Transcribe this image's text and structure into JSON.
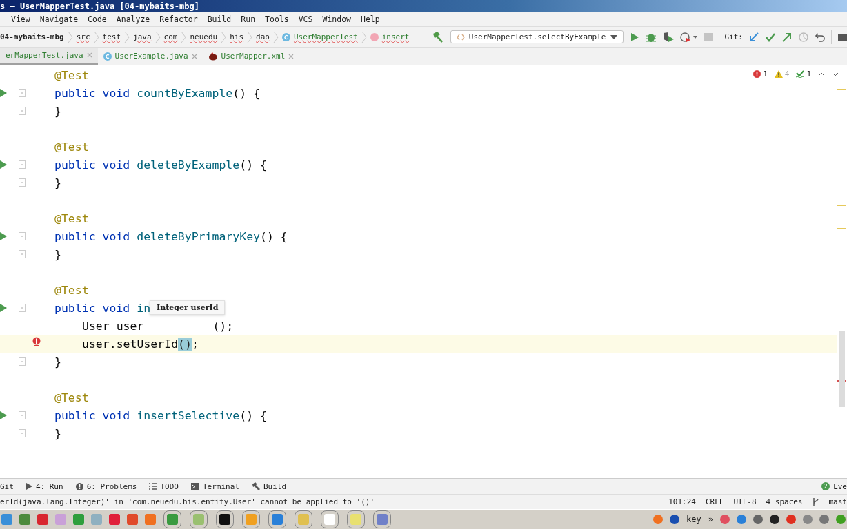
{
  "window": {
    "title": "s – UserMapperTest.java [04-mybaits-mbg]"
  },
  "menu": [
    "View",
    "Navigate",
    "Code",
    "Analyze",
    "Refactor",
    "Build",
    "Run",
    "Tools",
    "VCS",
    "Window",
    "Help"
  ],
  "breadcrumbs": [
    {
      "label": "04-mybaits-mbg",
      "kind": "project"
    },
    {
      "label": "src",
      "kind": "folder"
    },
    {
      "label": "test",
      "kind": "folder"
    },
    {
      "label": "java",
      "kind": "folder"
    },
    {
      "label": "com",
      "kind": "folder"
    },
    {
      "label": "neuedu",
      "kind": "folder"
    },
    {
      "label": "his",
      "kind": "folder"
    },
    {
      "label": "dao",
      "kind": "folder"
    },
    {
      "label": "UserMapperTest",
      "kind": "class"
    },
    {
      "label": "insert",
      "kind": "method"
    }
  ],
  "run_config": "UserMapperTest.selectByExample",
  "git_label": "Git:",
  "tabs": [
    {
      "label": "erMapperTest.java",
      "selected": true,
      "kind": "none"
    },
    {
      "label": "UserExample.java",
      "selected": false,
      "kind": "class"
    },
    {
      "label": "UserMapper.xml",
      "selected": false,
      "kind": "xml"
    }
  ],
  "inspections": {
    "errors": "1",
    "warnings": "4",
    "typos": "1"
  },
  "code": [
    {
      "kind": "plain",
      "segments": [
        {
          "kind": "annotation",
          "text": "@Test"
        }
      ]
    },
    {
      "kind": "run",
      "segments": [
        {
          "kind": "keyword",
          "text": "public void "
        },
        {
          "kind": "method",
          "text": "countByExample"
        },
        {
          "kind": "plain",
          "text": "() {"
        }
      ]
    },
    {
      "kind": "fold",
      "segments": [
        {
          "kind": "plain",
          "text": "}"
        }
      ]
    },
    {
      "kind": "blank"
    },
    {
      "kind": "plain",
      "segments": [
        {
          "kind": "annotation",
          "text": "@Test"
        }
      ]
    },
    {
      "kind": "run",
      "segments": [
        {
          "kind": "keyword",
          "text": "public void "
        },
        {
          "kind": "method",
          "text": "deleteByExample"
        },
        {
          "kind": "plain",
          "text": "() {"
        }
      ]
    },
    {
      "kind": "fold",
      "segments": [
        {
          "kind": "plain",
          "text": "}"
        }
      ]
    },
    {
      "kind": "blank"
    },
    {
      "kind": "plain",
      "segments": [
        {
          "kind": "annotation",
          "text": "@Test"
        }
      ]
    },
    {
      "kind": "run",
      "segments": [
        {
          "kind": "keyword",
          "text": "public void "
        },
        {
          "kind": "method",
          "text": "deleteByPrimaryKey"
        },
        {
          "kind": "plain",
          "text": "() {"
        }
      ]
    },
    {
      "kind": "fold",
      "segments": [
        {
          "kind": "plain",
          "text": "}"
        }
      ]
    },
    {
      "kind": "blank"
    },
    {
      "kind": "plain",
      "segments": [
        {
          "kind": "annotation",
          "text": "@Test"
        }
      ]
    },
    {
      "kind": "run",
      "segments": [
        {
          "kind": "keyword",
          "text": "public void "
        },
        {
          "kind": "method",
          "text": "in"
        }
      ]
    },
    {
      "kind": "plain",
      "indent": true,
      "segments": [
        {
          "kind": "plain",
          "text": "User user",
          "gap_after": true
        },
        {
          "kind": "plain",
          "text": "();"
        }
      ]
    },
    {
      "kind": "error",
      "indent": true,
      "current": true,
      "segments": [
        {
          "kind": "plain",
          "text": "user.setUserId"
        },
        {
          "kind": "highlight",
          "text": "()"
        },
        {
          "kind": "plain",
          "text": ";"
        }
      ]
    },
    {
      "kind": "fold",
      "segments": [
        {
          "kind": "plain",
          "text": "}"
        }
      ]
    },
    {
      "kind": "blank"
    },
    {
      "kind": "plain",
      "segments": [
        {
          "kind": "annotation",
          "text": "@Test"
        }
      ]
    },
    {
      "kind": "run",
      "segments": [
        {
          "kind": "keyword",
          "text": "public void "
        },
        {
          "kind": "method",
          "text": "insertSelective"
        },
        {
          "kind": "plain",
          "text": "() {"
        }
      ]
    },
    {
      "kind": "fold",
      "segments": [
        {
          "kind": "plain",
          "text": "}"
        }
      ]
    }
  ],
  "tooltip": "Integer userId",
  "tool_windows": [
    {
      "label": "Git",
      "kind": "none"
    },
    {
      "number": "4",
      "label": ": Run",
      "kind": "run"
    },
    {
      "number": "6",
      "label": ": Problems",
      "kind": "problems"
    },
    {
      "label": "TODO",
      "kind": "list"
    },
    {
      "label": "Terminal",
      "kind": "terminal"
    },
    {
      "label": "Build",
      "kind": "build"
    }
  ],
  "event_log": {
    "count": "2",
    "label": "Eve"
  },
  "status": {
    "message": "erId(java.lang.Integer)' in 'com.neuedu.his.entity.User' cannot be applied to '()'",
    "items": [
      "101:24",
      "CRLF",
      "UTF-8",
      "4 spaces",
      "mast"
    ]
  },
  "taskbar": {
    "apps": [
      {
        "color": "#3a8fd8"
      },
      {
        "color": "#4d8a3c"
      },
      {
        "color": "#d8262f"
      },
      {
        "color": "#c9a0d8"
      },
      {
        "color": "#2f9e3d"
      },
      {
        "color": "#8fb0c0"
      },
      {
        "color": "#e0203a"
      },
      {
        "color": "#e04a2a"
      },
      {
        "color": "#f07020"
      },
      {
        "color": "#3a9a40"
      },
      {
        "color": "#9ac070"
      },
      {
        "color": "#111111"
      },
      {
        "color": "#f0a020"
      },
      {
        "color": "#2a80d8"
      },
      {
        "color": "#e0c050"
      },
      {
        "color": "#ffffff"
      },
      {
        "color": "#e8e070"
      },
      {
        "color": "#7080c8"
      }
    ],
    "key_label": "key",
    "more": "»",
    "tray": [
      {
        "color": "#f07020"
      },
      {
        "color": "#1a4fb0"
      },
      {
        "color": "#e05060"
      },
      {
        "color": "#2a80d8"
      },
      {
        "color": "#666666"
      },
      {
        "color": "#222222"
      },
      {
        "color": "#e03020"
      },
      {
        "color": "#888888"
      },
      {
        "color": "#777777"
      },
      {
        "color": "#40a020"
      }
    ]
  }
}
